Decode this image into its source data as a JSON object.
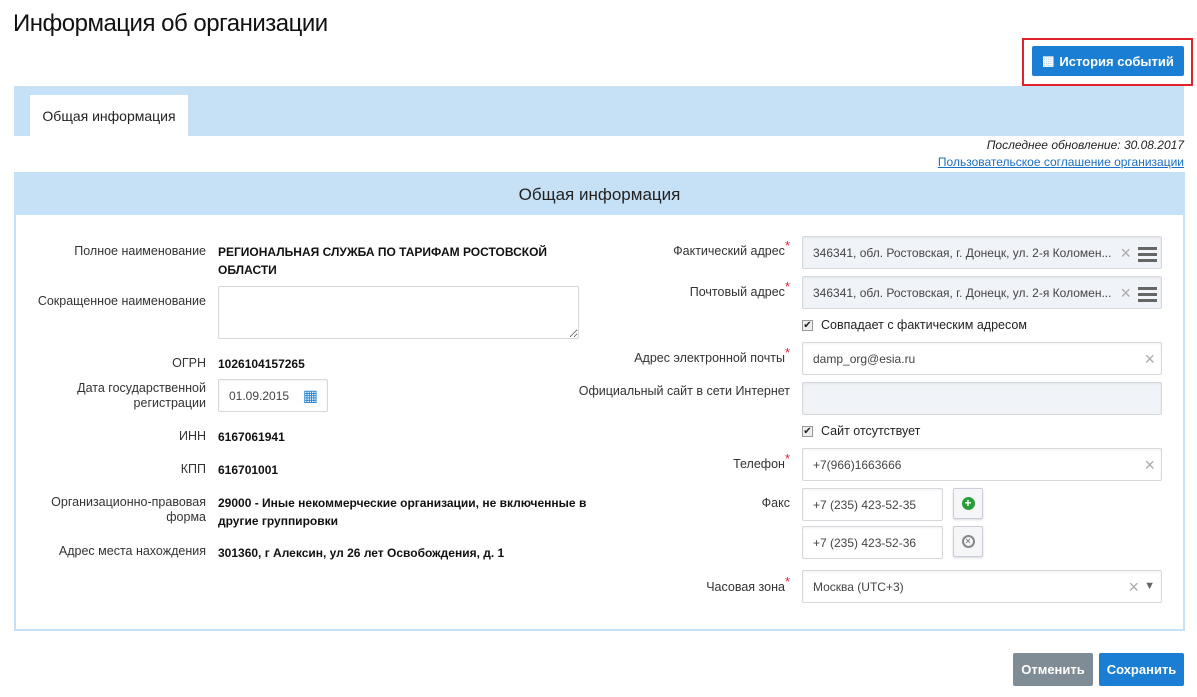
{
  "page_title": "Информация об организации",
  "history_button": "История событий",
  "tab": "Общая информация",
  "last_update": "Последнее обновление: 30.08.2017",
  "agreement_link": "Пользовательское соглашение организации",
  "panel_title": "Общая информация",
  "left": {
    "full_name_label": "Полное наименование",
    "full_name": "РЕГИОНАЛЬНАЯ СЛУЖБА ПО ТАРИФАМ РОСТОВСКОЙ ОБЛАСТИ",
    "short_name_label": "Сокращенное наименование",
    "short_name": "",
    "ogrn_label": "ОГРН",
    "ogrn": "1026104157265",
    "reg_date_label": "Дата государственной регистрации",
    "reg_date": "01.09.2015",
    "inn_label": "ИНН",
    "inn": "6167061941",
    "kpp_label": "КПП",
    "kpp": "616701001",
    "opf_label": "Организационно-правовая форма",
    "opf": "29000 - Иные некоммерческие организации, не включенные в другие группировки",
    "location_label": "Адрес места нахождения",
    "location": "301360, г Алексин, ул 26 лет Освобождения, д. 1"
  },
  "right": {
    "actual_address_label": "Фактический адрес",
    "actual_address": "346341, обл. Ростовская, г. Донецк, ул. 2-я Коломен...",
    "postal_address_label": "Почтовый адрес",
    "postal_address": "346341, обл. Ростовская, г. Донецк, ул. 2-я Коломен...",
    "same_address_label": "Совпадает с фактическим адресом",
    "same_address_checked": true,
    "email_label": "Адрес электронной почты",
    "email": "damp_org@esia.ru",
    "website_label": "Официальный сайт в сети Интернет",
    "website": "",
    "no_site_label": "Сайт отсутствует",
    "no_site_checked": true,
    "phone_label": "Телефон",
    "phone": "+7(966)1663666",
    "fax_label": "Факс",
    "fax1": "+7 (235) 423-52-35",
    "fax2": "+7 (235) 423-52-36",
    "timezone_label": "Часовая зона",
    "timezone": "Москва (UTC+3)"
  },
  "required_mark": "*",
  "cancel_button": "Отменить",
  "save_button": "Сохранить",
  "colors": {
    "primary": "#1a7fd4",
    "secondary": "#7f8c96",
    "highlight": "#e0222a",
    "panel": "#c6e0f6"
  }
}
